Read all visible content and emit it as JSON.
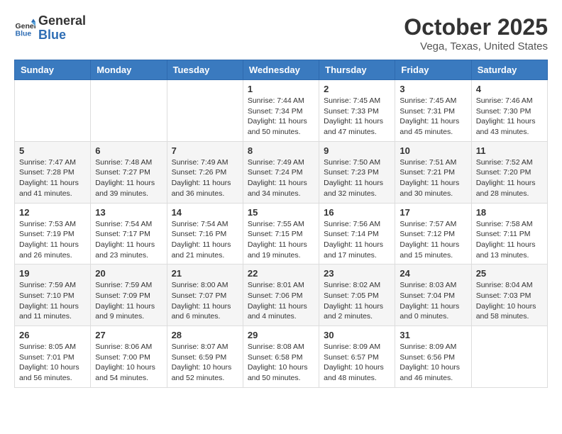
{
  "logo": {
    "text_general": "General",
    "text_blue": "Blue"
  },
  "header": {
    "month": "October 2025",
    "location": "Vega, Texas, United States"
  },
  "weekdays": [
    "Sunday",
    "Monday",
    "Tuesday",
    "Wednesday",
    "Thursday",
    "Friday",
    "Saturday"
  ],
  "weeks": [
    [
      {
        "day": "",
        "sunrise": "",
        "sunset": "",
        "daylight": ""
      },
      {
        "day": "",
        "sunrise": "",
        "sunset": "",
        "daylight": ""
      },
      {
        "day": "",
        "sunrise": "",
        "sunset": "",
        "daylight": ""
      },
      {
        "day": "1",
        "sunrise": "Sunrise: 7:44 AM",
        "sunset": "Sunset: 7:34 PM",
        "daylight": "Daylight: 11 hours and 50 minutes."
      },
      {
        "day": "2",
        "sunrise": "Sunrise: 7:45 AM",
        "sunset": "Sunset: 7:33 PM",
        "daylight": "Daylight: 11 hours and 47 minutes."
      },
      {
        "day": "3",
        "sunrise": "Sunrise: 7:45 AM",
        "sunset": "Sunset: 7:31 PM",
        "daylight": "Daylight: 11 hours and 45 minutes."
      },
      {
        "day": "4",
        "sunrise": "Sunrise: 7:46 AM",
        "sunset": "Sunset: 7:30 PM",
        "daylight": "Daylight: 11 hours and 43 minutes."
      }
    ],
    [
      {
        "day": "5",
        "sunrise": "Sunrise: 7:47 AM",
        "sunset": "Sunset: 7:28 PM",
        "daylight": "Daylight: 11 hours and 41 minutes."
      },
      {
        "day": "6",
        "sunrise": "Sunrise: 7:48 AM",
        "sunset": "Sunset: 7:27 PM",
        "daylight": "Daylight: 11 hours and 39 minutes."
      },
      {
        "day": "7",
        "sunrise": "Sunrise: 7:49 AM",
        "sunset": "Sunset: 7:26 PM",
        "daylight": "Daylight: 11 hours and 36 minutes."
      },
      {
        "day": "8",
        "sunrise": "Sunrise: 7:49 AM",
        "sunset": "Sunset: 7:24 PM",
        "daylight": "Daylight: 11 hours and 34 minutes."
      },
      {
        "day": "9",
        "sunrise": "Sunrise: 7:50 AM",
        "sunset": "Sunset: 7:23 PM",
        "daylight": "Daylight: 11 hours and 32 minutes."
      },
      {
        "day": "10",
        "sunrise": "Sunrise: 7:51 AM",
        "sunset": "Sunset: 7:21 PM",
        "daylight": "Daylight: 11 hours and 30 minutes."
      },
      {
        "day": "11",
        "sunrise": "Sunrise: 7:52 AM",
        "sunset": "Sunset: 7:20 PM",
        "daylight": "Daylight: 11 hours and 28 minutes."
      }
    ],
    [
      {
        "day": "12",
        "sunrise": "Sunrise: 7:53 AM",
        "sunset": "Sunset: 7:19 PM",
        "daylight": "Daylight: 11 hours and 26 minutes."
      },
      {
        "day": "13",
        "sunrise": "Sunrise: 7:54 AM",
        "sunset": "Sunset: 7:17 PM",
        "daylight": "Daylight: 11 hours and 23 minutes."
      },
      {
        "day": "14",
        "sunrise": "Sunrise: 7:54 AM",
        "sunset": "Sunset: 7:16 PM",
        "daylight": "Daylight: 11 hours and 21 minutes."
      },
      {
        "day": "15",
        "sunrise": "Sunrise: 7:55 AM",
        "sunset": "Sunset: 7:15 PM",
        "daylight": "Daylight: 11 hours and 19 minutes."
      },
      {
        "day": "16",
        "sunrise": "Sunrise: 7:56 AM",
        "sunset": "Sunset: 7:14 PM",
        "daylight": "Daylight: 11 hours and 17 minutes."
      },
      {
        "day": "17",
        "sunrise": "Sunrise: 7:57 AM",
        "sunset": "Sunset: 7:12 PM",
        "daylight": "Daylight: 11 hours and 15 minutes."
      },
      {
        "day": "18",
        "sunrise": "Sunrise: 7:58 AM",
        "sunset": "Sunset: 7:11 PM",
        "daylight": "Daylight: 11 hours and 13 minutes."
      }
    ],
    [
      {
        "day": "19",
        "sunrise": "Sunrise: 7:59 AM",
        "sunset": "Sunset: 7:10 PM",
        "daylight": "Daylight: 11 hours and 11 minutes."
      },
      {
        "day": "20",
        "sunrise": "Sunrise: 7:59 AM",
        "sunset": "Sunset: 7:09 PM",
        "daylight": "Daylight: 11 hours and 9 minutes."
      },
      {
        "day": "21",
        "sunrise": "Sunrise: 8:00 AM",
        "sunset": "Sunset: 7:07 PM",
        "daylight": "Daylight: 11 hours and 6 minutes."
      },
      {
        "day": "22",
        "sunrise": "Sunrise: 8:01 AM",
        "sunset": "Sunset: 7:06 PM",
        "daylight": "Daylight: 11 hours and 4 minutes."
      },
      {
        "day": "23",
        "sunrise": "Sunrise: 8:02 AM",
        "sunset": "Sunset: 7:05 PM",
        "daylight": "Daylight: 11 hours and 2 minutes."
      },
      {
        "day": "24",
        "sunrise": "Sunrise: 8:03 AM",
        "sunset": "Sunset: 7:04 PM",
        "daylight": "Daylight: 11 hours and 0 minutes."
      },
      {
        "day": "25",
        "sunrise": "Sunrise: 8:04 AM",
        "sunset": "Sunset: 7:03 PM",
        "daylight": "Daylight: 10 hours and 58 minutes."
      }
    ],
    [
      {
        "day": "26",
        "sunrise": "Sunrise: 8:05 AM",
        "sunset": "Sunset: 7:01 PM",
        "daylight": "Daylight: 10 hours and 56 minutes."
      },
      {
        "day": "27",
        "sunrise": "Sunrise: 8:06 AM",
        "sunset": "Sunset: 7:00 PM",
        "daylight": "Daylight: 10 hours and 54 minutes."
      },
      {
        "day": "28",
        "sunrise": "Sunrise: 8:07 AM",
        "sunset": "Sunset: 6:59 PM",
        "daylight": "Daylight: 10 hours and 52 minutes."
      },
      {
        "day": "29",
        "sunrise": "Sunrise: 8:08 AM",
        "sunset": "Sunset: 6:58 PM",
        "daylight": "Daylight: 10 hours and 50 minutes."
      },
      {
        "day": "30",
        "sunrise": "Sunrise: 8:09 AM",
        "sunset": "Sunset: 6:57 PM",
        "daylight": "Daylight: 10 hours and 48 minutes."
      },
      {
        "day": "31",
        "sunrise": "Sunrise: 8:09 AM",
        "sunset": "Sunset: 6:56 PM",
        "daylight": "Daylight: 10 hours and 46 minutes."
      },
      {
        "day": "",
        "sunrise": "",
        "sunset": "",
        "daylight": ""
      }
    ]
  ]
}
